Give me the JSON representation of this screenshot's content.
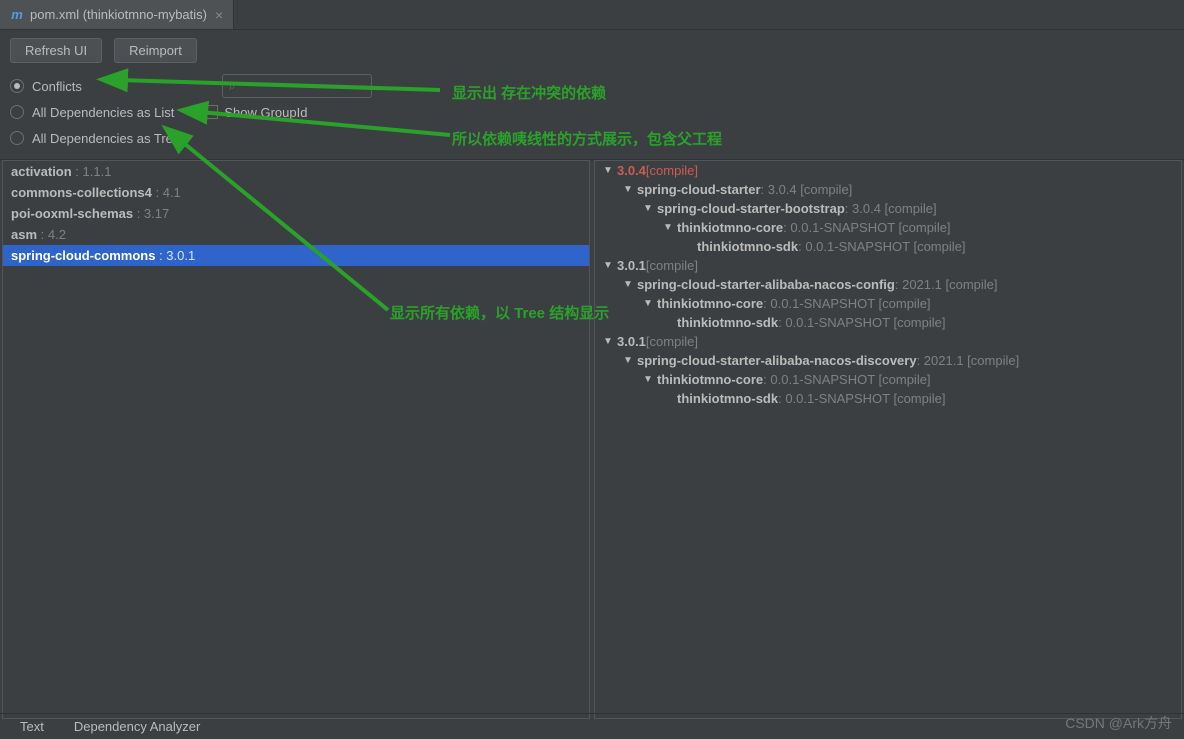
{
  "tab": {
    "title": "pom.xml (thinkiotmno-mybatis)"
  },
  "toolbar": {
    "refresh": "Refresh UI",
    "reimport": "Reimport"
  },
  "filters": {
    "conflicts": "Conflicts",
    "list": "All Dependencies as List",
    "tree": "All Dependencies as Tree",
    "show_group": "Show GroupId"
  },
  "annotations": {
    "a1": "显示出 存在冲突的依赖",
    "a2": "所以依赖咦线性的方式展示，包含父工程",
    "a3": "显示所有依赖，以 Tree 结构显示"
  },
  "left": [
    {
      "name": "activation",
      "ver": "1.1.1",
      "sel": false
    },
    {
      "name": "commons-collections4",
      "ver": "4.1",
      "sel": false
    },
    {
      "name": "poi-ooxml-schemas",
      "ver": "3.17",
      "sel": false
    },
    {
      "name": "asm",
      "ver": "4.2",
      "sel": false
    },
    {
      "name": "spring-cloud-commons",
      "ver": "3.0.1",
      "sel": true
    }
  ],
  "tree": [
    {
      "d": 0,
      "name": "",
      "ver": "3.0.4",
      "scope": "[compile]",
      "conflict": true
    },
    {
      "d": 1,
      "name": "spring-cloud-starter",
      "ver": "3.0.4",
      "scope": "[compile]"
    },
    {
      "d": 2,
      "name": "spring-cloud-starter-bootstrap",
      "ver": "3.0.4",
      "scope": "[compile]"
    },
    {
      "d": 3,
      "name": "thinkiotmno-core",
      "ver": "0.0.1-SNAPSHOT",
      "scope": "[compile]"
    },
    {
      "d": 4,
      "name": "thinkiotmno-sdk",
      "ver": "0.0.1-SNAPSHOT",
      "scope": "[compile]",
      "leaf": true
    },
    {
      "d": 0,
      "name": "",
      "ver": "3.0.1",
      "scope": "[compile]"
    },
    {
      "d": 1,
      "name": "spring-cloud-starter-alibaba-nacos-config",
      "ver": "2021.1",
      "scope": "[compile]"
    },
    {
      "d": 2,
      "name": "thinkiotmno-core",
      "ver": "0.0.1-SNAPSHOT",
      "scope": "[compile]"
    },
    {
      "d": 3,
      "name": "thinkiotmno-sdk",
      "ver": "0.0.1-SNAPSHOT",
      "scope": "[compile]",
      "leaf": true
    },
    {
      "d": 0,
      "name": "",
      "ver": "3.0.1",
      "scope": "[compile]"
    },
    {
      "d": 1,
      "name": "spring-cloud-starter-alibaba-nacos-discovery",
      "ver": "2021.1",
      "scope": "[compile]"
    },
    {
      "d": 2,
      "name": "thinkiotmno-core",
      "ver": "0.0.1-SNAPSHOT",
      "scope": "[compile]"
    },
    {
      "d": 3,
      "name": "thinkiotmno-sdk",
      "ver": "0.0.1-SNAPSHOT",
      "scope": "[compile]",
      "leaf": true
    }
  ],
  "status": {
    "text": "Text",
    "analyzer": "Dependency Analyzer"
  },
  "watermark": "CSDN @Ark方舟"
}
